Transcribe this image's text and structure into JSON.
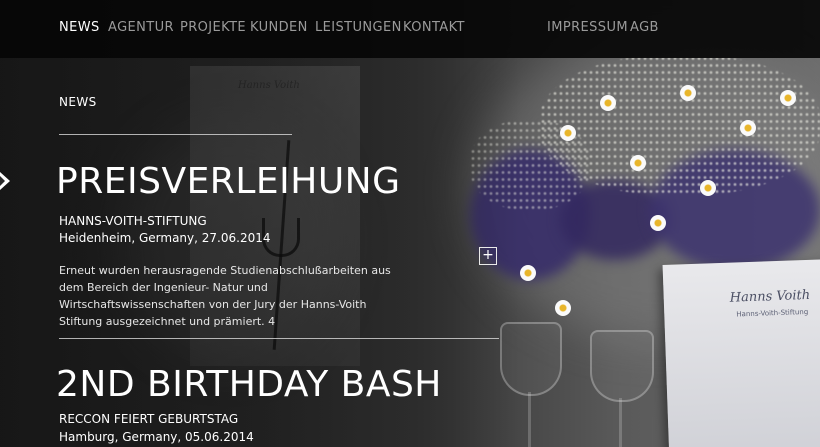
{
  "nav": {
    "primary": [
      "NEWS",
      "AGENTUR",
      "PROJEKTE",
      "KUNDEN",
      "LEISTUNGEN",
      "KONTAKT"
    ],
    "secondary": [
      "IMPRESSUM",
      "AGB"
    ],
    "active": "NEWS"
  },
  "section": {
    "title": "NEWS"
  },
  "articles": [
    {
      "headline": "PREISVERLEIHUNG",
      "subtitle": "HANNS-VOITH-STIFTUNG",
      "meta": "Heidenheim, Germany, 27.06.2014",
      "text": "Erneut wurden herausragende Studienabschlußarbeiten aus dem Bereich der Ingenieur- Natur und Wirtschaftswissenschaften von der Jury der Hanns-Voith Stiftung ausgezeichnet und prämiert. 4"
    },
    {
      "headline": "2ND BIRTHDAY BASH",
      "subtitle": "RECCON FEIERT GEBURTSTAG",
      "meta": "Hamburg, Germany, 05.06.2014"
    }
  ],
  "controls": {
    "expand_icon": "plus-icon",
    "arrow_icon": "arrow-right-icon"
  },
  "background": {
    "card_signature": "Hanns Voith",
    "card_subtitle": "Hanns-Voith-Stiftung"
  },
  "colors": {
    "nav_bg": "#060606",
    "nav_inactive": "#9a9a9a",
    "text": "#ffffff"
  }
}
